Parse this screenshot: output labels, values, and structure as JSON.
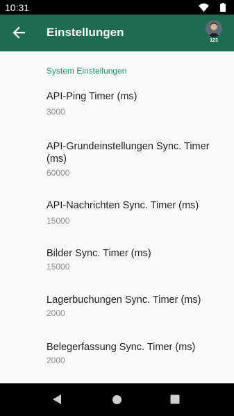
{
  "status_bar": {
    "time": "10:31"
  },
  "app_bar": {
    "title": "Einstellungen",
    "user_badge": "123"
  },
  "section": {
    "header": "System Einstellungen"
  },
  "preferences": [
    {
      "title": "API-Ping Timer (ms)",
      "value": "3000"
    },
    {
      "title": "API-Grundeinstellungen Sync. Timer (ms)",
      "value": "60000"
    },
    {
      "title": "API-Nachrichten Sync. Timer (ms)",
      "value": "15000"
    },
    {
      "title": "Bilder Sync. Timer (ms)",
      "value": "15000"
    },
    {
      "title": "Lagerbuchungen Sync. Timer (ms)",
      "value": "2000"
    },
    {
      "title": "Belegerfassung Sync. Timer (ms)",
      "value": "2000"
    }
  ],
  "colors": {
    "app_bar": "#1e6b52",
    "accent": "#1f8f74",
    "background": "#fafafa"
  },
  "icons": {
    "back": "arrow-left-icon",
    "avatar": "user-avatar-icon",
    "wifi": "wifi-icon",
    "battery": "battery-icon",
    "nav_back": "triangle-back-icon",
    "nav_home": "circle-home-icon",
    "nav_recents": "square-recents-icon"
  }
}
